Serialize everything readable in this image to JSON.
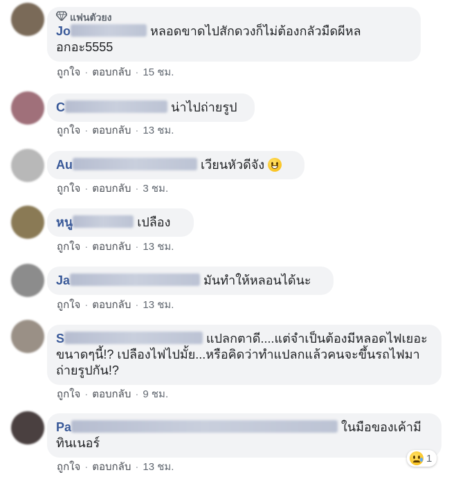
{
  "top_fan_badge": "แฟนตัวยง",
  "action_like": "ถูกใจ",
  "action_reply": "ตอบกลับ",
  "comments": [
    {
      "name": "Jo",
      "text": "หลอดขาดไปสักดวงก็ไม่ต้องกลัวมืดผีหลอกอะ5555",
      "time": "15 ชม.",
      "avatar_color": "#7a6a58"
    },
    {
      "name": "C",
      "text": "น่าไปถ่ายรูป",
      "time": "13 ชม.",
      "avatar_color": "#a0707a"
    },
    {
      "name": "Au",
      "text": "เวียนหัวดีจัง",
      "time": "3 ชม.",
      "avatar_color": "#b8b8b8"
    },
    {
      "name": "หนู",
      "text": "เปลือง",
      "time": "13 ชม.",
      "avatar_color": "#8a7a55"
    },
    {
      "name": "Ja",
      "text": "มันทำให้หลอนได้นะ",
      "time": "13 ชม.",
      "avatar_color": "#8c8c8c"
    },
    {
      "name": "S",
      "text": "แปลกตาดี....แต่จำเป็นต้องมีหลอดไฟเยอะขนาดๆนี้!? เปลืองไฟไปมั้ย...หรือคิดว่าทำแปลกแล้วคนจะขึ้นรถไฟมาถ่ายรูปกัน!?",
      "time": "9 ชม.",
      "avatar_color": "#9a9086"
    },
    {
      "name": "Pa",
      "text": "ในมือของเค้ามีทินเนอร์",
      "time": "13 ชม.",
      "avatar_color": "#4a4040",
      "reaction_count": "1"
    }
  ]
}
